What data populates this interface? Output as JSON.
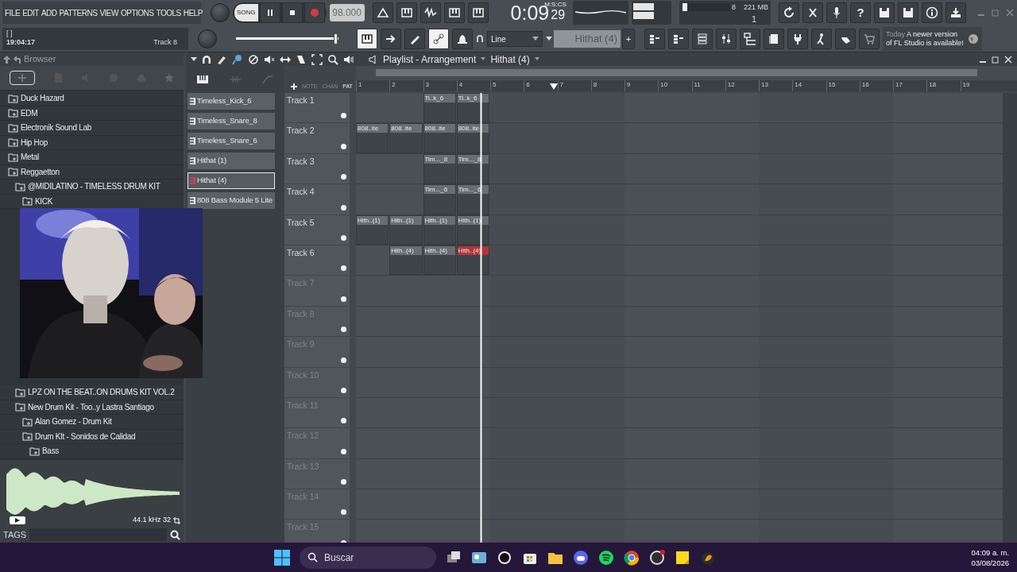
{
  "menu": [
    "FILE",
    "EDIT",
    "ADD",
    "PATTERNS",
    "VIEW",
    "OPTIONS",
    "TOOLS",
    "HELP"
  ],
  "hint_panel": {
    "brackets": "[  ]",
    "time": "19:04:17",
    "track": "Track 8"
  },
  "transport": {
    "mode": "SONG",
    "tempo": "98.000"
  },
  "song_time": {
    "main": "0:09",
    "unit": "M:S:CS",
    "centi": "29"
  },
  "cpu": {
    "value": "8",
    "memory": "221 MB",
    "polyphony": "1"
  },
  "help_glyph": "?",
  "master_volume": {
    "level": 0.97
  },
  "snap": "Line",
  "pattern_selector": {
    "name": "Hithat (4)",
    "add": "+"
  },
  "news": {
    "when": "Today",
    "message": "A newer version of FL Studio is available!"
  },
  "browser": {
    "title": "Browser",
    "tree": [
      {
        "label": "Duck Hazard"
      },
      {
        "label": "EDM"
      },
      {
        "label": "Electronik Sound Lab"
      },
      {
        "label": "Hip Hop"
      },
      {
        "label": "Metal"
      },
      {
        "label": "Reggaetton",
        "children": [
          {
            "label": "@MIDILATINO - TIMELESS DRUM KIT",
            "children": [
              {
                "label": "KICK"
              }
            ]
          },
          {
            "label": "LPZ ON THE BEAT..ON DRUMS KIT VOL.2"
          },
          {
            "label": "New Drum Kit - Too..y Lastra Santiago",
            "children": [
              {
                "label": "Alan Gomez -  Drum Kit"
              },
              {
                "label": "Drum KIt - Sonidos de Calidad",
                "children": [
                  {
                    "label": "Bass"
                  }
                ]
              }
            ]
          }
        ]
      }
    ],
    "sample_info": "44.1 kHz 32",
    "tags_label": "TAGS"
  },
  "playlist": {
    "title": "Playlist - Arrangement",
    "pattern": "Hithat (4)",
    "filters": [
      "NOTE",
      "CHAN",
      "PAT"
    ],
    "bars": [
      "1",
      "2",
      "3",
      "4",
      "5",
      "6",
      "7",
      "8",
      "9",
      "10",
      "11",
      "12",
      "13",
      "14",
      "15",
      "16",
      "17",
      "18",
      "19"
    ],
    "patterns": [
      {
        "label": "Timeless_Kick_6",
        "selected": false
      },
      {
        "label": "Timeless_Snare_8",
        "selected": false
      },
      {
        "label": "Timeless_Snare_6",
        "selected": false
      },
      {
        "label": "Hithat (1)",
        "selected": false
      },
      {
        "label": "Hithat (4)",
        "selected": true
      },
      {
        "label": "808 Bass Module 5 Lite",
        "selected": false
      }
    ],
    "tracks": [
      {
        "label": "Track 1",
        "on": true,
        "clips": [
          {
            "kind": "empty"
          },
          {
            "kind": "empty"
          },
          {
            "kind": "pattern",
            "label": "Ti..k_6",
            "selected": false
          },
          {
            "kind": "pattern",
            "label": "Ti..k_6",
            "selected": false
          }
        ]
      },
      {
        "label": "Track 2",
        "on": true,
        "clips": [
          {
            "kind": "pattern",
            "label": "808..ite",
            "selected": false
          },
          {
            "kind": "pattern",
            "label": "808..ite",
            "selected": false
          },
          {
            "kind": "pattern",
            "label": "808..ite",
            "selected": false
          },
          {
            "kind": "pattern",
            "label": "808..ite",
            "selected": false
          }
        ]
      },
      {
        "label": "Track 3",
        "on": true,
        "clips": [
          {
            "kind": "empty"
          },
          {
            "kind": "empty"
          },
          {
            "kind": "pattern",
            "label": "Tim..._8",
            "selected": false
          },
          {
            "kind": "pattern",
            "label": "Tim..._8",
            "selected": false
          }
        ]
      },
      {
        "label": "Track 4",
        "on": true,
        "clips": [
          {
            "kind": "empty"
          },
          {
            "kind": "empty"
          },
          {
            "kind": "pattern",
            "label": "Tim..._6",
            "selected": false
          },
          {
            "kind": "pattern",
            "label": "Tim..._6",
            "selected": false
          }
        ]
      },
      {
        "label": "Track 5",
        "on": true,
        "clips": [
          {
            "kind": "pattern",
            "label": "Hith..(1)",
            "selected": false
          },
          {
            "kind": "pattern",
            "label": "Hith..(1)",
            "selected": false
          },
          {
            "kind": "pattern",
            "label": "Hith..(1)",
            "selected": false
          },
          {
            "kind": "pattern",
            "label": "Hith..(1)",
            "selected": false
          }
        ]
      },
      {
        "label": "Track 6",
        "on": true,
        "clips": [
          {
            "kind": "empty"
          },
          {
            "kind": "pattern",
            "label": "Hith..(4)",
            "selected": false
          },
          {
            "kind": "pattern",
            "label": "Hith..(4)",
            "selected": false
          },
          {
            "kind": "pattern",
            "label": "Hith..(4)",
            "selected": true
          }
        ]
      },
      {
        "label": "Track 7",
        "on": true
      },
      {
        "label": "Track 8",
        "on": true
      },
      {
        "label": "Track 9",
        "on": true
      },
      {
        "label": "Track 10",
        "on": true
      },
      {
        "label": "Track 11",
        "on": true
      },
      {
        "label": "Track 12",
        "on": true
      },
      {
        "label": "Track 13",
        "on": true
      },
      {
        "label": "Track 14",
        "on": true
      },
      {
        "label": "Track 15",
        "on": true
      }
    ]
  },
  "taskbar": {
    "search": "Buscar",
    "time": "04:09 a. m.",
    "date": "03/08/2026"
  }
}
